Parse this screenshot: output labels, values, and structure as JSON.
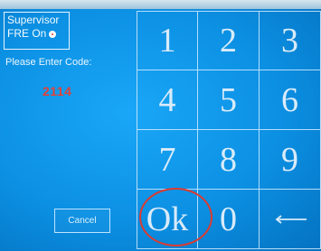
{
  "supervisor": {
    "title": "Supervisor",
    "fre_label": "FRE On"
  },
  "prompt": {
    "label": "Please Enter Code:",
    "code": "2114"
  },
  "buttons": {
    "cancel": "Cancel",
    "ok": "Ok"
  },
  "keypad": {
    "digits": [
      "1",
      "2",
      "3",
      "4",
      "5",
      "6",
      "7",
      "8",
      "9",
      "0"
    ],
    "backspace_icon": "backspace-arrow-icon"
  },
  "colors": {
    "background": "#0c90e3",
    "code_text": "#e0413a",
    "highlight": "#dc3a30",
    "key_text": "#d8ebf9"
  }
}
